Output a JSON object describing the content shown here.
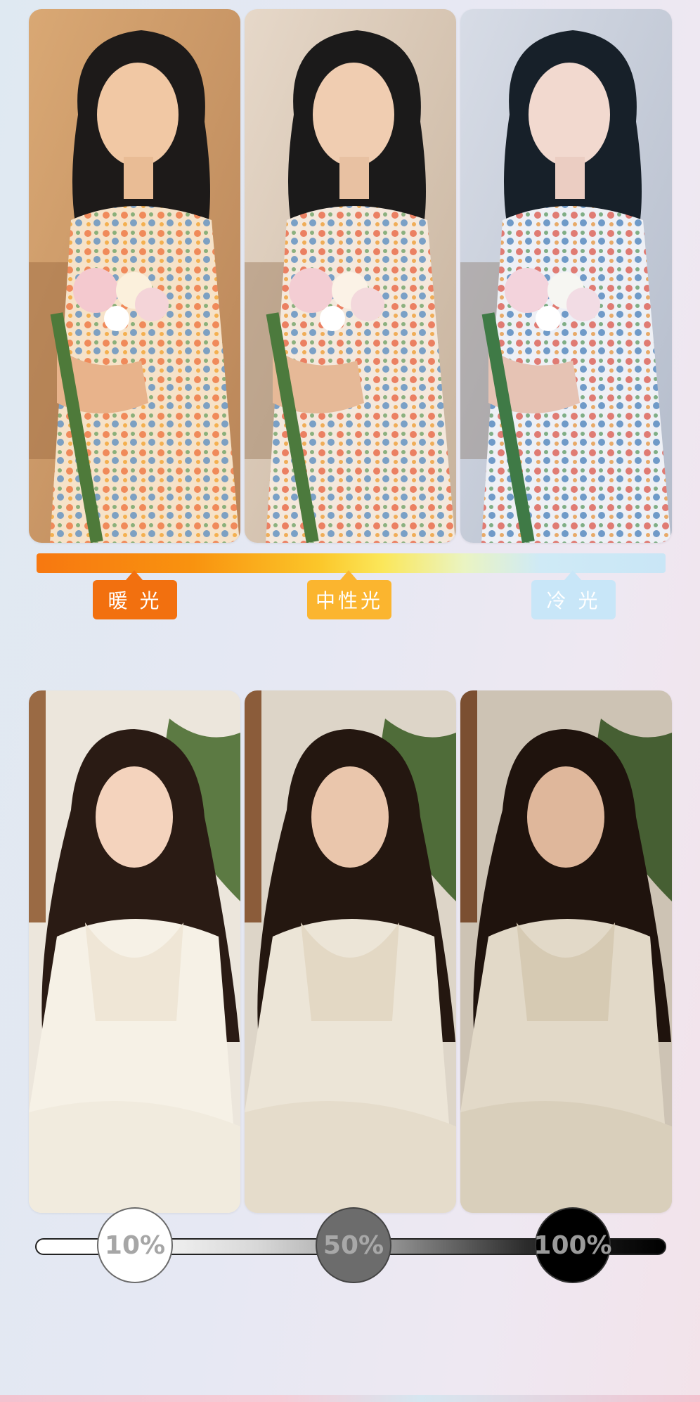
{
  "temperature_section": {
    "labels": {
      "warm": "暖 光",
      "neutral": "中性光",
      "cool": "冷 光"
    },
    "colors": {
      "warm": "#f2700f",
      "neutral": "#fbb52f",
      "cool": "#c8e6f8"
    },
    "photos": [
      {
        "name": "warm-light-photo",
        "tint": "#f3c79a"
      },
      {
        "name": "neutral-light-photo",
        "tint": "#e9d7c6"
      },
      {
        "name": "cool-light-photo",
        "tint": "#cdd8e6"
      }
    ]
  },
  "brightness_section": {
    "labels": {
      "low": "10%",
      "mid": "50%",
      "high": "100%"
    },
    "levels": [
      0.1,
      0.5,
      1.0
    ],
    "photos": [
      {
        "name": "brightness-10-photo"
      },
      {
        "name": "brightness-50-photo"
      },
      {
        "name": "brightness-100-photo"
      }
    ]
  }
}
